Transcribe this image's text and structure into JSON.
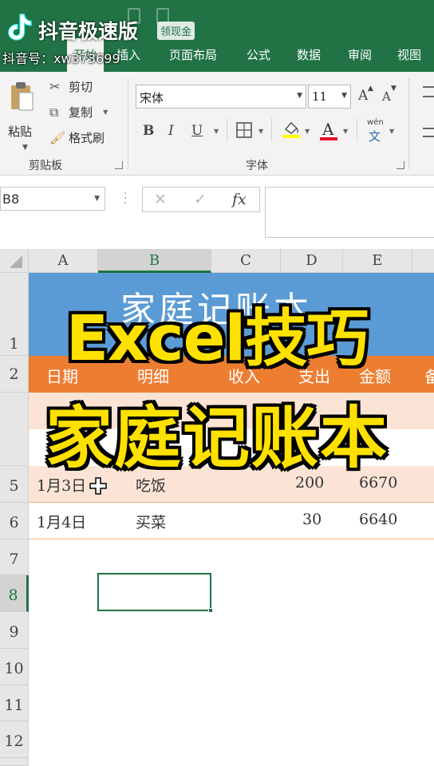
{
  "douyin": {
    "app_name": "抖音极速版",
    "reward_badge": "领现金",
    "account_id": "抖音号：xw373699"
  },
  "ribbon_tabs": [
    {
      "label": "开始",
      "active": true
    },
    {
      "label": "插入",
      "active": false
    },
    {
      "label": "页面布局",
      "active": false
    },
    {
      "label": "公式",
      "active": false
    },
    {
      "label": "数据",
      "active": false
    },
    {
      "label": "审阅",
      "active": false
    },
    {
      "label": "视图",
      "active": false
    }
  ],
  "clipboard": {
    "paste_label": "粘贴",
    "cut_label": "剪切",
    "copy_label": "复制",
    "format_painter_label": "格式刷",
    "group_label": "剪贴板"
  },
  "font": {
    "family": "宋体",
    "size": "11",
    "grow_label": "A",
    "shrink_label": "A",
    "bold": "B",
    "italic": "I",
    "underline": "U",
    "font_color_label": "A",
    "phonetic_top": "wén",
    "phonetic_bottom": "文",
    "group_label": "字体",
    "font_color": "#e81123",
    "fill_color": "#ffff00"
  },
  "formula_bar": {
    "name_box": "B8",
    "cancel": "✕",
    "enter": "✓",
    "fx": "fx",
    "value": ""
  },
  "columns": [
    {
      "label": "A",
      "selected": false
    },
    {
      "label": "B",
      "selected": true
    },
    {
      "label": "C",
      "selected": false
    },
    {
      "label": "D",
      "selected": false
    },
    {
      "label": "E",
      "selected": false
    }
  ],
  "rows": [
    {
      "label": "1",
      "selected": false
    },
    {
      "label": "2",
      "selected": false
    },
    {
      "label": "5",
      "selected": false
    },
    {
      "label": "6",
      "selected": false
    },
    {
      "label": "7",
      "selected": false
    },
    {
      "label": "8",
      "selected": true
    },
    {
      "label": "9",
      "selected": false
    },
    {
      "label": "10",
      "selected": false
    },
    {
      "label": "11",
      "selected": false
    },
    {
      "label": "12",
      "selected": false
    }
  ],
  "sheet": {
    "title": "家庭记账本",
    "headers": [
      "日期",
      "明细",
      "收入",
      "支出",
      "金额",
      "备"
    ],
    "rows": [
      {
        "date": "1月3日",
        "detail": "吃饭",
        "expense": "200",
        "balance": "6670"
      },
      {
        "date": "1月4日",
        "detail": "买菜",
        "expense": "30",
        "balance": "6640"
      }
    ],
    "title_color": "#5b9bd5",
    "header_color": "#ed7d31",
    "band_color": "#fbe4d6"
  },
  "caption": {
    "line1": "Excel技巧",
    "line2": "家庭记账本",
    "color": "#ffe100"
  }
}
